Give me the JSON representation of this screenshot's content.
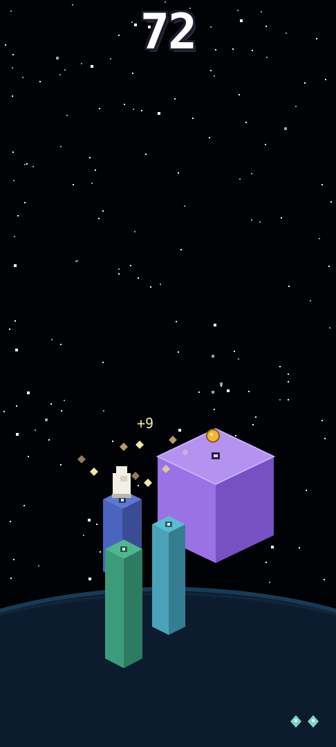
{
  "hud": {
    "score": "72"
  },
  "popup": {
    "bonus_text": "+9"
  },
  "colors": {
    "sky": "#000205",
    "planet_surface": "#0c1c2e",
    "planet_rim": "#183a57",
    "player": "#f1efe6",
    "coin": "#f1b72e",
    "sparkle": "#f3e7a5",
    "lives_icon": "#7cd6c4"
  },
  "pillars": [
    {
      "name": "blue-pillar",
      "colors": {
        "top": "#5d78d2",
        "left": "#4a64bf",
        "right": "#3a4d94"
      }
    },
    {
      "name": "green-pillar",
      "colors": {
        "top": "#51b58f",
        "left": "#3c9c7a",
        "right": "#2d7b60"
      }
    },
    {
      "name": "teal-pillar",
      "colors": {
        "top": "#5abcd3",
        "left": "#4aa3b8",
        "right": "#357e92"
      }
    },
    {
      "name": "purple-cube",
      "colors": {
        "top": "#b392f0",
        "left": "#9a72e6",
        "right": "#7750c3"
      }
    }
  ],
  "lives": {
    "count": 2,
    "icon": "diamond-sparkle-icon"
  }
}
